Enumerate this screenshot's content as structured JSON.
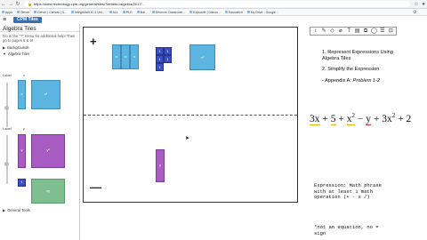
{
  "browser": {
    "url": "https://www.technology.cpm.org/general/tiles/?details=/algebra/2017/...",
    "bookmarks": [
      "Apps",
      "Clever",
      "Clever | Canvas | S...",
      "IntegrMath IC-1 Uni...",
      "ALL",
      "PLG",
      "Bal...",
      "Desmos Classroom...",
      "Edpuzzle | Discou...",
      "Education",
      "My Drive - Google..."
    ]
  },
  "app": {
    "name": "CPM Tiles",
    "menu_icon": "hamburger-menu-icon"
  },
  "sidebar": {
    "title": "Algebra Tiles",
    "help": "Go to the \"?\" menu for additional help! Then go to pages 8 & 9!",
    "sections": [
      {
        "label": "Backgrounds",
        "expanded": false
      },
      {
        "label": "Algebra Tiles",
        "expanded": true
      },
      {
        "label": "General Tools",
        "expanded": false
      }
    ],
    "label_1": "Label",
    "label_1_value": "x",
    "label_2": "Label",
    "label_2_value": "y",
    "tile_x_label": "x",
    "tile_x2_label": "x²",
    "tile_y_label": "y",
    "tile_y2_label": "y²",
    "tile_one_label": "1",
    "tile_xy_label": "xy"
  },
  "workspace": {
    "plus": "+",
    "minus": "—",
    "tile_x_labels": [
      "x",
      "x",
      "x"
    ],
    "tile_unit_labels": [
      "1",
      "1",
      "1",
      "1",
      "1"
    ],
    "tile_x2_label": "x²",
    "tile_y_label": "y"
  },
  "toolbar": {
    "buttons": [
      "↕",
      "✎",
      "◇",
      "⌀",
      "T",
      "▤",
      "⧉",
      "◯",
      "☰",
      "⊡"
    ]
  },
  "notes": {
    "item1": "1. Represent Expressions Using Algebra Tiles",
    "item2": "2. Simplify the Expression",
    "item3_prefix": "- Appendix A: ",
    "item3_italic": "Problem 1-2",
    "expression_parts": [
      "3x",
      "+",
      "5",
      "+",
      "x",
      "2",
      "−",
      "y",
      "+",
      "3x",
      "2",
      "+",
      "2"
    ],
    "definition": "Expression: Math phrase\nwith at least 1 math\noperation (+ - x /)",
    "footnote": "*not an equation, no =\nsign"
  },
  "colors": {
    "x_tile": "#5bb5e0",
    "unit_tile": "#3a4ec2",
    "y_tile": "#a85bc2",
    "y2_tile": "#a85bc2",
    "xy_tile": "#7fbf8f"
  }
}
